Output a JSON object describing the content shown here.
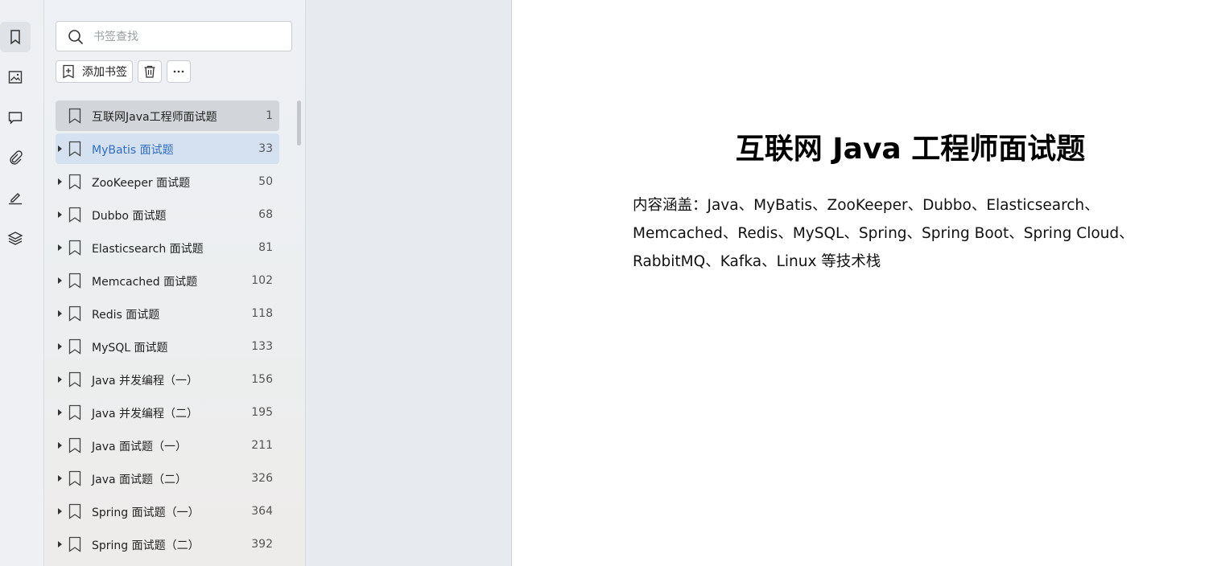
{
  "sidebar_tabs": [
    {
      "name": "bookmark-icon",
      "active": true
    },
    {
      "name": "thumbnail-icon",
      "active": false
    },
    {
      "name": "comment-icon",
      "active": false
    },
    {
      "name": "attachment-icon",
      "active": false
    },
    {
      "name": "signature-icon",
      "active": false
    },
    {
      "name": "layers-icon",
      "active": false
    }
  ],
  "search": {
    "placeholder": "书签查找"
  },
  "toolbar": {
    "add_label": "添加书签"
  },
  "bookmarks": [
    {
      "label": "互联网Java工程师面试题",
      "page": "1",
      "expandable": false
    },
    {
      "label": "MyBatis 面试题",
      "page": "33",
      "expandable": true
    },
    {
      "label": "ZooKeeper 面试题",
      "page": "50",
      "expandable": true
    },
    {
      "label": "Dubbo 面试题",
      "page": "68",
      "expandable": true
    },
    {
      "label": "Elasticsearch 面试题",
      "page": "81",
      "expandable": true
    },
    {
      "label": "Memcached 面试题",
      "page": "102",
      "expandable": true
    },
    {
      "label": "Redis 面试题",
      "page": "118",
      "expandable": true
    },
    {
      "label": "MySQL 面试题",
      "page": "133",
      "expandable": true
    },
    {
      "label": "Java 并发编程（一）",
      "page": "156",
      "expandable": true
    },
    {
      "label": "Java 并发编程（二）",
      "page": "195",
      "expandable": true
    },
    {
      "label": "Java 面试题（一）",
      "page": "211",
      "expandable": true
    },
    {
      "label": "Java 面试题（二）",
      "page": "326",
      "expandable": true
    },
    {
      "label": "Spring 面试题（一）",
      "page": "364",
      "expandable": true
    },
    {
      "label": "Spring 面试题（二）",
      "page": "392",
      "expandable": true
    }
  ],
  "document": {
    "title": "互联网 Java 工程师面试题",
    "body": "内容涵盖：Java、MyBatis、ZooKeeper、Dubbo、Elasticsearch、Memcached、Redis、MySQL、Spring、Spring Boot、Spring Cloud、RabbitMQ、Kafka、Linux 等技术栈"
  },
  "colors": {
    "selected_link": "#2f6fbf",
    "selected_bg": "#d5e1f0"
  }
}
